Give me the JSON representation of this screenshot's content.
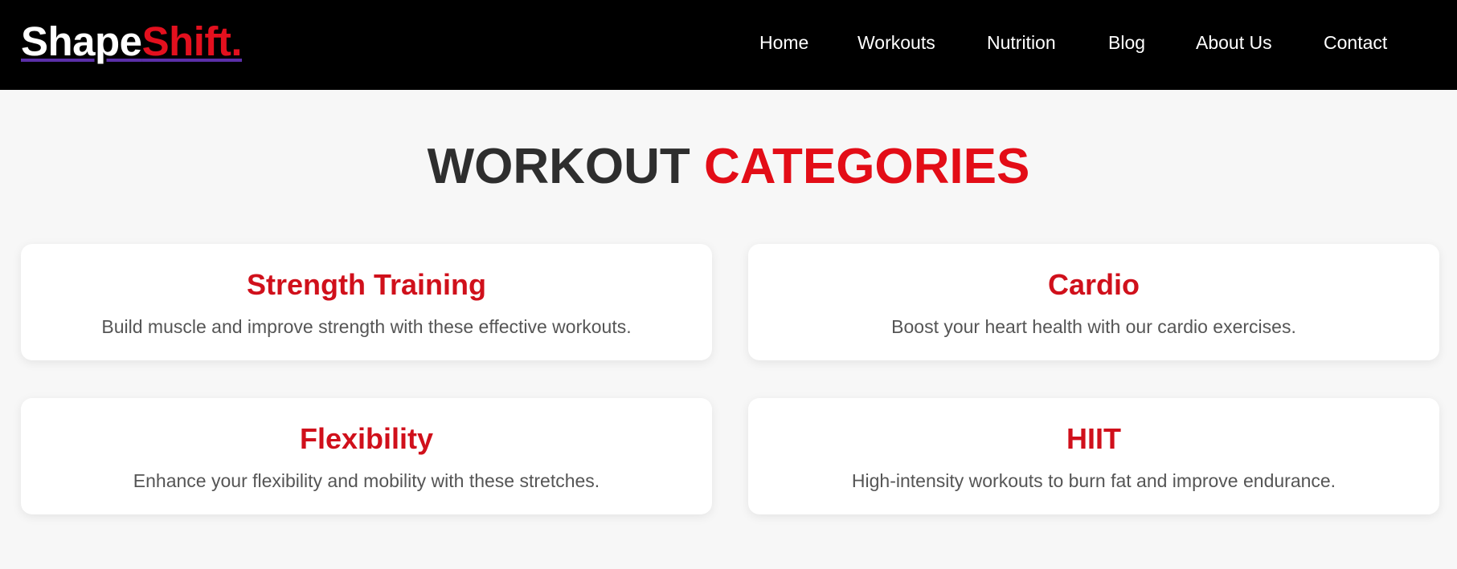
{
  "nav": {
    "logo_part1": "Shape",
    "logo_part2": "Shift.",
    "links": [
      "Home",
      "Workouts",
      "Nutrition",
      "Blog",
      "About Us",
      "Contact"
    ]
  },
  "main": {
    "title_part1": "WORKOUT",
    "title_part2": "CATEGORIES",
    "cards": [
      {
        "title": "Strength Training",
        "desc": "Build muscle and improve strength with these effective workouts."
      },
      {
        "title": "Cardio",
        "desc": "Boost your heart health with our cardio exercises."
      },
      {
        "title": "Flexibility",
        "desc": "Enhance your flexibility and mobility with these stretches."
      },
      {
        "title": "HIIT",
        "desc": "High-intensity workouts to burn fat and improve endurance."
      }
    ]
  },
  "colors": {
    "navbar_bg": "#000000",
    "accent_red": "#e30d17",
    "page_bg": "#f7f7f7"
  }
}
